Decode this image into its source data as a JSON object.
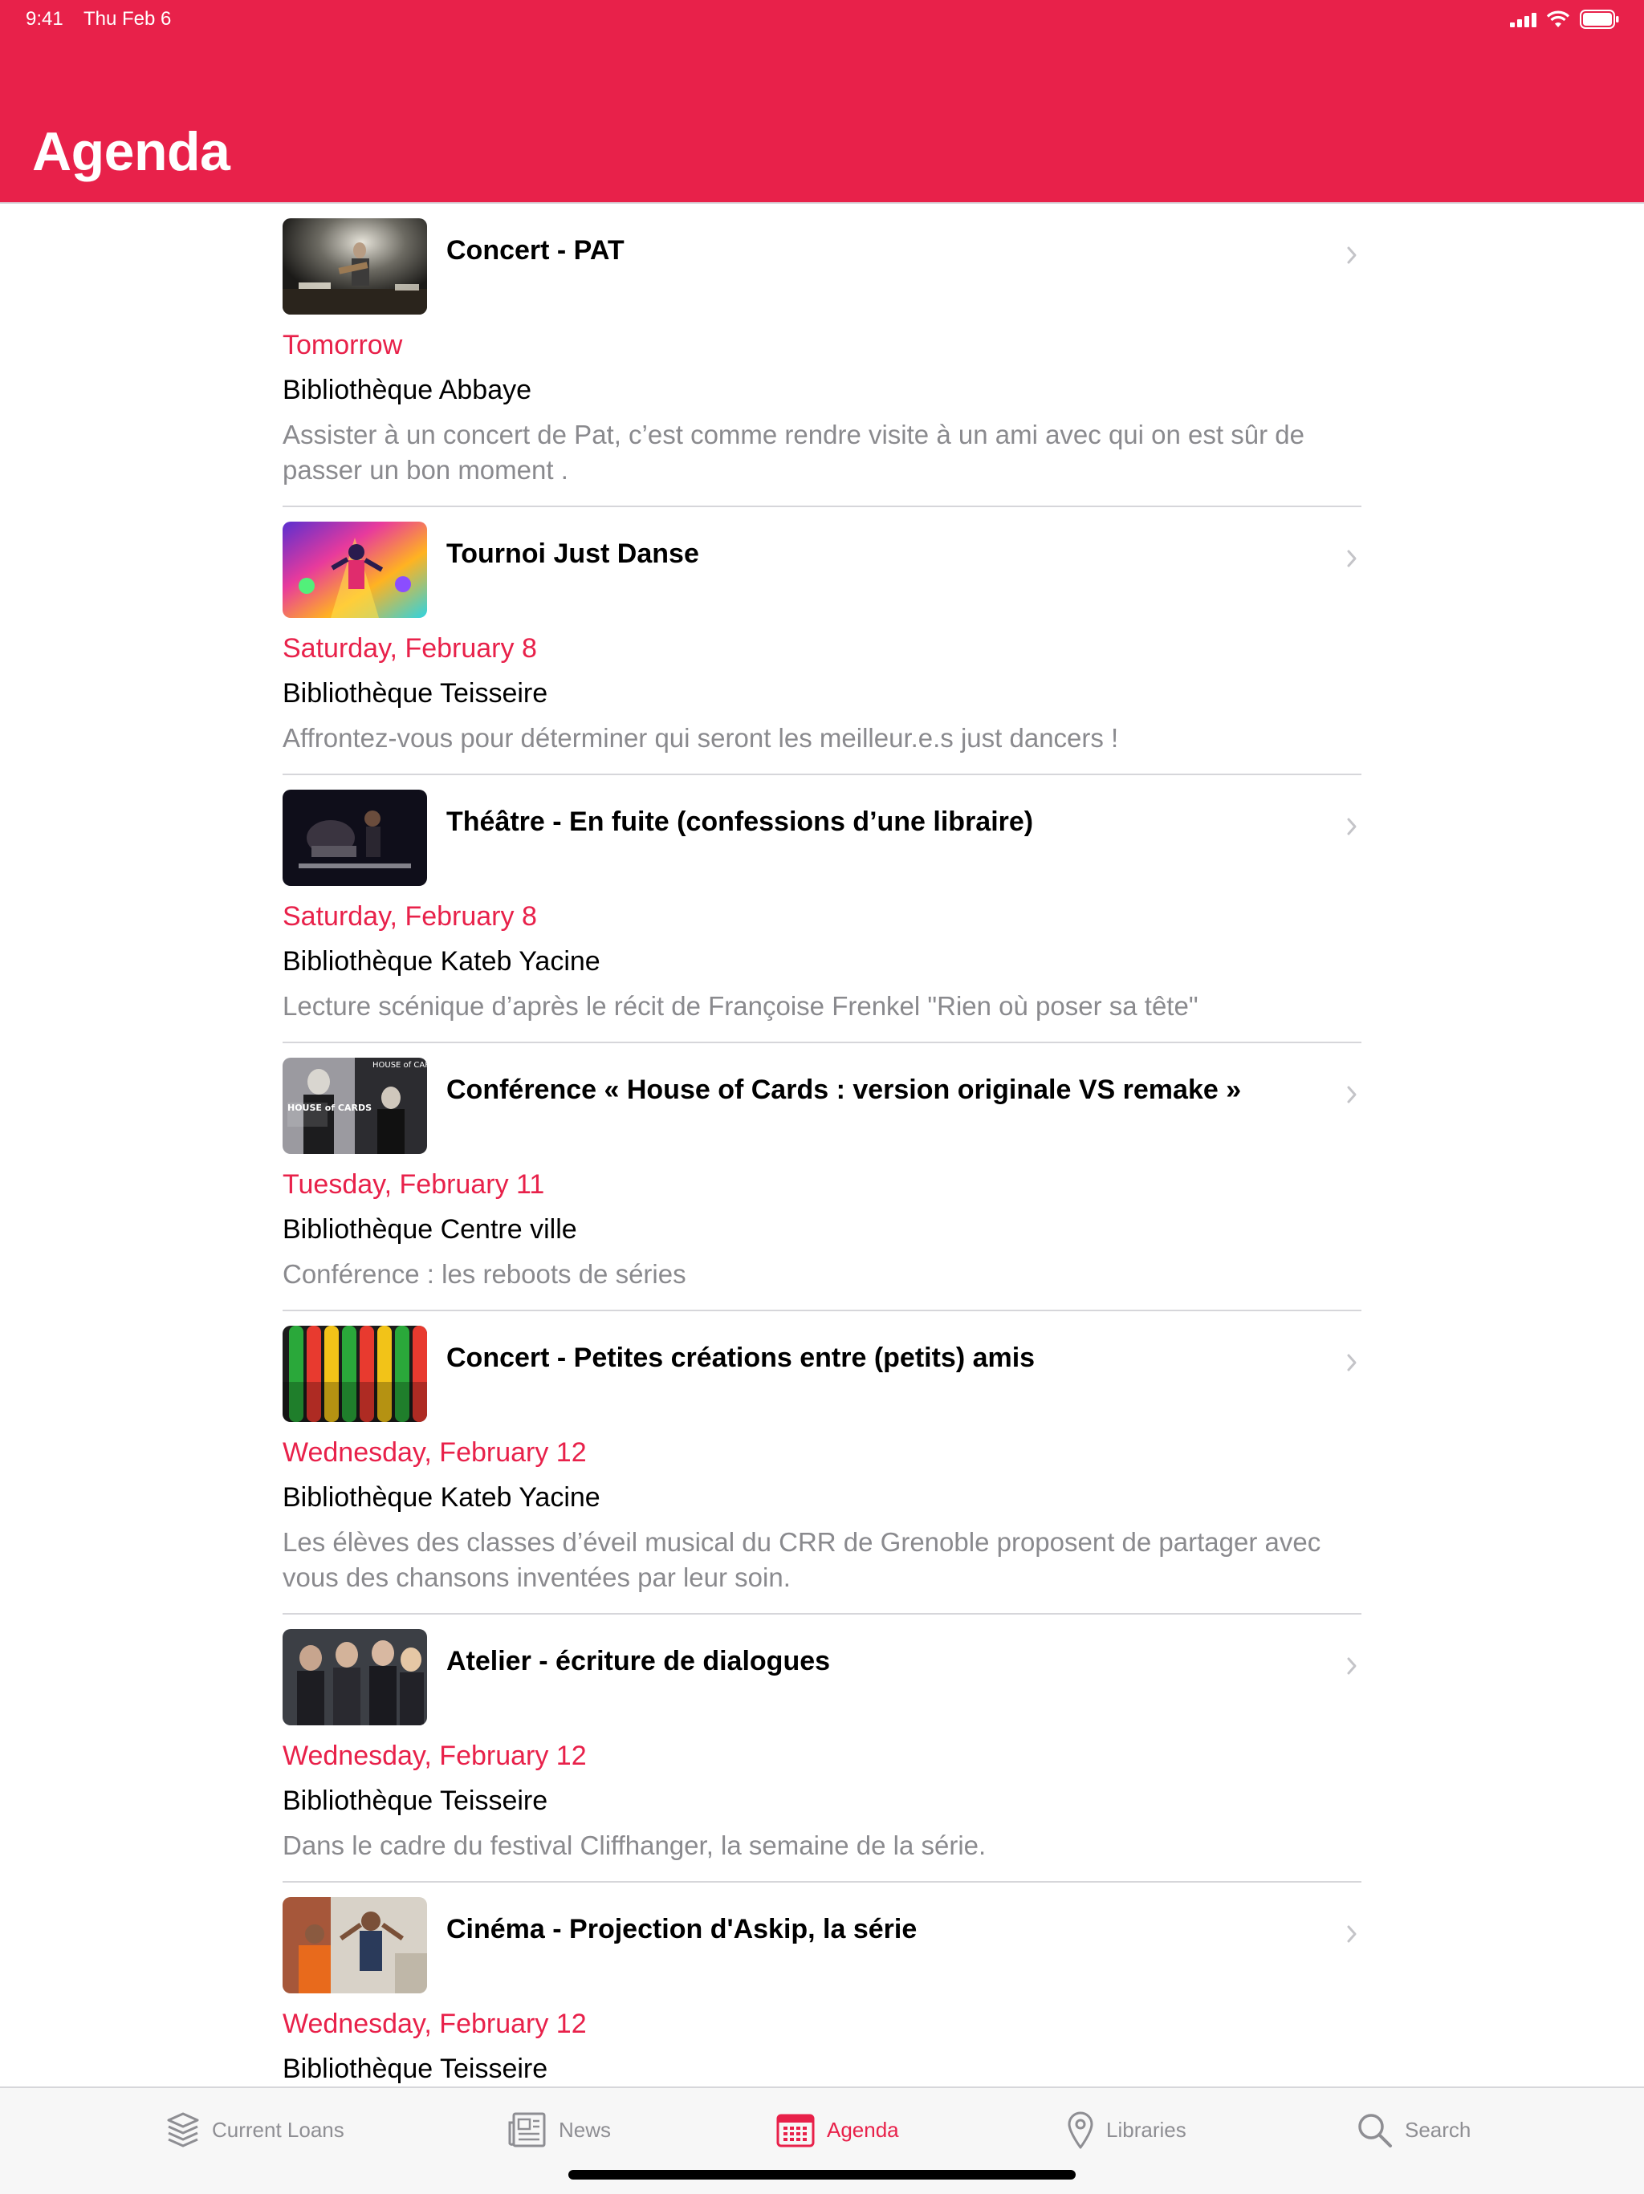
{
  "status": {
    "time": "9:41",
    "date": "Thu Feb 6"
  },
  "header": {
    "title": "Agenda"
  },
  "events": [
    {
      "title": "Concert - PAT",
      "date": "Tomorrow",
      "library": "Bibliothèque Abbaye",
      "description": "Assister à un concert de Pat, c’est comme rendre visite à un ami avec qui on est sûr de passer un bon moment ."
    },
    {
      "title": "Tournoi Just Danse",
      "date": "Saturday, February 8",
      "library": "Bibliothèque Teisseire",
      "description": "Affrontez-vous pour déterminer qui seront les meilleur.e.s just dancers !"
    },
    {
      "title": "Théâtre - En fuite (confessions d’une libraire)",
      "date": "Saturday, February 8",
      "library": "Bibliothèque Kateb Yacine",
      "description": "Lecture scénique d’après le récit de Françoise Frenkel \"Rien où poser sa tête\""
    },
    {
      "title": "Conférence « House of Cards : version originale VS remake »",
      "date": "Tuesday, February 11",
      "library": "Bibliothèque Centre ville",
      "description": "Conférence : les reboots de séries"
    },
    {
      "title": "Concert - Petites créations entre (petits) amis",
      "date": "Wednesday, February 12",
      "library": "Bibliothèque Kateb Yacine",
      "description": "Les élèves des classes d’éveil musical du CRR de Grenoble proposent de partager avec vous des chansons inventées par leur soin."
    },
    {
      "title": "Atelier - écriture de dialogues",
      "date": "Wednesday, February 12",
      "library": "Bibliothèque Teisseire",
      "description": "Dans le cadre du festival Cliffhanger, la semaine de la série."
    },
    {
      "title": "Cinéma - Projection d'Askip, la série",
      "date": "Wednesday, February 12",
      "library": "Bibliothèque Teisseire",
      "description": ""
    }
  ],
  "thumbnail_text": {
    "house_of_cards_left": "HOUSE of CARDS",
    "house_of_cards_right": "HOUSE of CARDS"
  },
  "tabbar": {
    "tabs": [
      {
        "label": "Current Loans",
        "icon": "stack-icon",
        "active": false
      },
      {
        "label": "News",
        "icon": "newspaper-icon",
        "active": false
      },
      {
        "label": "Agenda",
        "icon": "calendar-icon",
        "active": true
      },
      {
        "label": "Libraries",
        "icon": "location-pin-icon",
        "active": false
      },
      {
        "label": "Search",
        "icon": "search-icon",
        "active": false
      }
    ]
  },
  "colors": {
    "accent": "#e8214a",
    "secondary_text": "#8a8a8e",
    "tab_inactive": "#8e8e93"
  }
}
